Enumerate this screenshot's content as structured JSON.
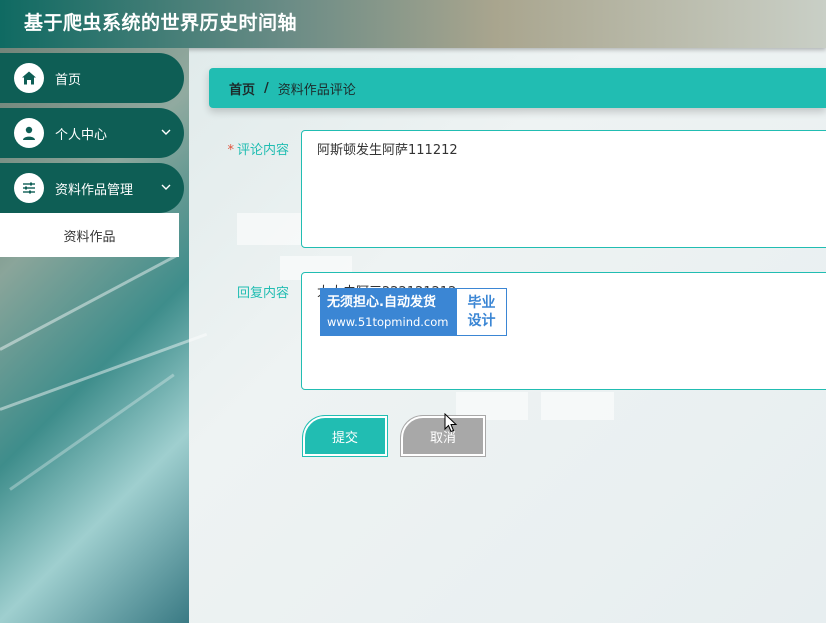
{
  "app": {
    "title": "基于爬虫系统的世界历史时间轴"
  },
  "sidebar": {
    "items": [
      {
        "label": "首页",
        "icon": "home-icon"
      },
      {
        "label": "个人中心",
        "icon": "user-icon"
      },
      {
        "label": "资料作品管理",
        "icon": "sliders-icon"
      }
    ],
    "submenu": [
      {
        "label": "资料作品"
      }
    ]
  },
  "breadcrumb": {
    "home": "首页",
    "separator": "/",
    "current": "资料作品评论"
  },
  "form": {
    "comment_label": "评论内容",
    "comment_required_mark": "*",
    "comment_value": "阿斯顿发生阿萨111212",
    "reply_label": "回复内容",
    "reply_value": "大大去阿三222121212"
  },
  "buttons": {
    "submit": "提交",
    "cancel": "取消"
  },
  "watermark": {
    "line1": "无须担心.自动发货",
    "line2": "www.51topmind.com",
    "right_line1": "毕业",
    "right_line2": "设计"
  },
  "colors": {
    "accent": "#21bdb2",
    "sidebar_item": "#0e5e55",
    "cancel": "#a8a8a8",
    "watermark": "#3b86d4"
  }
}
